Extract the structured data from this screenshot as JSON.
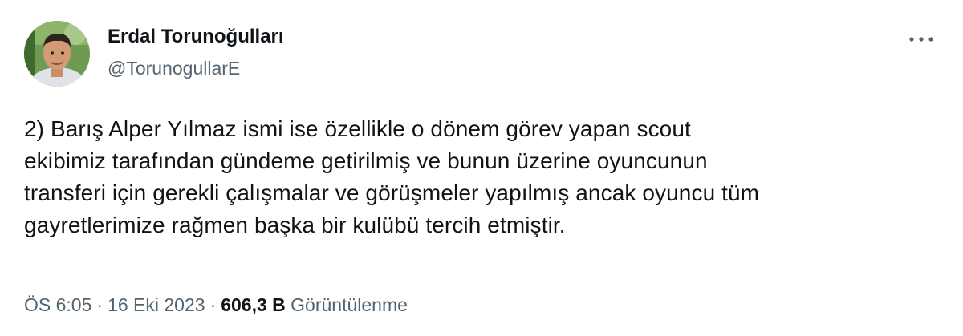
{
  "author": {
    "display_name": "Erdal Torunoğulları",
    "handle": "@TorunogullarE"
  },
  "tweet": {
    "lines": [
      "2) Barış Alper Yılmaz ismi ise özellikle o dönem görev yapan scout",
      "ekibimiz tarafından gündeme getirilmiş ve bunun üzerine oyuncunun",
      "transferi için gerekli çalışmalar ve görüşmeler yapılmış ancak oyuncu tüm",
      "gayretlerimize rağmen başka bir kulübü tercih etmiştir."
    ]
  },
  "meta": {
    "time": "ÖS 6:05",
    "separator": "·",
    "date": "16 Eki 2023",
    "views_count": "606,3 B",
    "views_label": "Görüntülenme"
  },
  "icons": {
    "more": "more-horizontal-icon",
    "avatar": "profile-photo"
  },
  "colors": {
    "text_primary": "#0f1419",
    "text_secondary": "#536471",
    "background": "#ffffff"
  }
}
